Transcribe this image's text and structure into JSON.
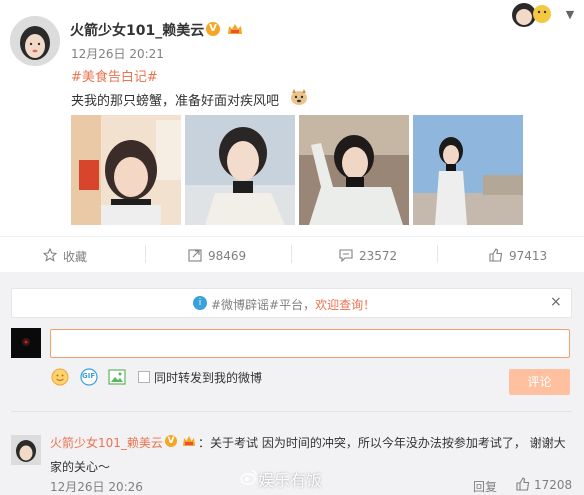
{
  "post": {
    "author": "火箭少女101_赖美云",
    "verified_badge": "V",
    "time": "12月26日 20:21",
    "hashtag": "#美食告白记#",
    "text": "夹我的那只螃蟹，准备好面对疾风吧"
  },
  "photos": [
    {
      "name": "photo-1",
      "colors": [
        "#f3e1d0",
        "#e8b89b",
        "#2d2a2a"
      ]
    },
    {
      "name": "photo-2",
      "colors": [
        "#c7d2dc",
        "#f1e8e0",
        "#222222"
      ]
    },
    {
      "name": "photo-3",
      "colors": [
        "#9a8676",
        "#e9ece8",
        "#1e1e1e"
      ]
    },
    {
      "name": "photo-4",
      "colors": [
        "#8fb7de",
        "#efeeee",
        "#1a1a1a"
      ]
    }
  ],
  "actions": {
    "favorite": "收藏",
    "forward_count": "98469",
    "comment_count": "23572",
    "like_count": "97413"
  },
  "notice": {
    "prefix": "#微博辟谣#平台，",
    "link": "欢迎查询！",
    "close": "×"
  },
  "composer": {
    "input_value": "",
    "also_forward": "同时转发到我的微博",
    "submit": "评论",
    "gif_label": "GIF"
  },
  "comment": {
    "author": "火箭少女101_赖美云",
    "verified_badge": "V",
    "text_line1": "：关于考试 因为时间的冲突，所以今年没办法按参加考试了， 谢谢大",
    "text_line2": "家的关心～",
    "time": "12月26日 20:26",
    "reply": "回复",
    "like_count": "17208"
  },
  "watermark": "娱乐有饭",
  "colors": {
    "accent": "#eb7350",
    "muted": "#808080",
    "comment_bg": "#f2f2f5",
    "submit_disabled": "#ffc09f"
  }
}
